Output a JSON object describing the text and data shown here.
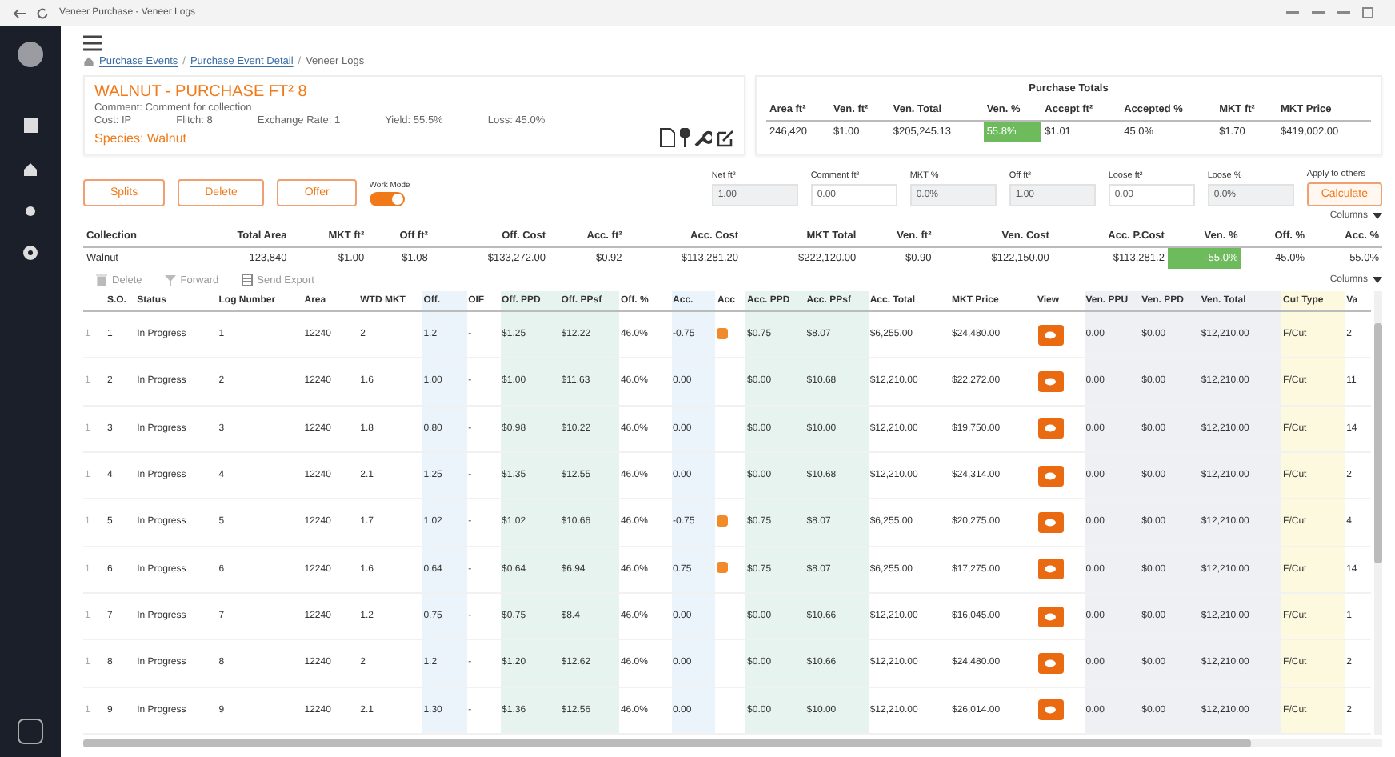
{
  "browser": {
    "title": "Veneer Purchase - Veneer Logs"
  },
  "breadcrumb": {
    "separator": "/",
    "items": [
      {
        "label": "Purchase Events",
        "link": true
      },
      {
        "label": "Purchase Event Detail",
        "link": true
      },
      {
        "label": "Veneer Logs",
        "link": false
      }
    ]
  },
  "header": {
    "title": "WALNUT - PURCHASE FT² 8",
    "comment": "Comment: Comment for collection",
    "facts": [
      "Cost: IP",
      "Flitch: 8",
      "Exchange Rate: 1",
      "Yield: 55.5%",
      "Loss: 45.0%"
    ],
    "species": "Species: Walnut"
  },
  "purchase_totals": {
    "title": "Purchase Totals",
    "columns": [
      "Area ft²",
      "Ven. ft²",
      "Ven. Total",
      "Ven. %",
      "Accept ft²",
      "Accepted %",
      "MKT ft²",
      "MKT Price"
    ],
    "values": [
      {
        "text": "246,420",
        "highlight": false
      },
      {
        "text": "$1.00",
        "highlight": false
      },
      {
        "text": "$205,245.13",
        "highlight": false
      },
      {
        "text": "55.8%",
        "highlight": true
      },
      {
        "text": "$1.01",
        "highlight": false
      },
      {
        "text": "45.0%",
        "highlight": false
      },
      {
        "text": "$1.70",
        "highlight": false
      },
      {
        "text": "$419,002.00",
        "highlight": false
      }
    ]
  },
  "actions": [
    "Splits",
    "Delete",
    "Offer"
  ],
  "work_mode": {
    "label": "Work Mode",
    "on": true
  },
  "fields": [
    {
      "label": "Net ft²",
      "value": "1.00",
      "readonly": true
    },
    {
      "label": "Comment ft²",
      "value": "0.00",
      "readonly": false
    },
    {
      "label": "MKT %",
      "value": "0.0%",
      "readonly": true
    },
    {
      "label": "Off ft²",
      "value": "1.00",
      "readonly": true
    },
    {
      "label": "Loose ft²",
      "value": "0.00",
      "readonly": false
    },
    {
      "label": "Loose %",
      "value": "0.0%",
      "readonly": true
    }
  ],
  "apply": {
    "label": "Apply to others",
    "button": "Calculate"
  },
  "summary": {
    "columns_button": "Columns",
    "columns": [
      "Collection",
      "Total Area",
      "MKT ft²",
      "Off ft²",
      "Off. Cost",
      "Acc. ft²",
      "Acc. Cost",
      "MKT Total",
      "Ven. ft²",
      "Ven. Cost",
      "Acc. P.Cost",
      "Ven. %",
      "Off. %",
      "Acc. %"
    ],
    "row": [
      {
        "text": "Walnut",
        "highlight": false
      },
      {
        "text": "123,840",
        "highlight": false
      },
      {
        "text": "$1.00",
        "highlight": false
      },
      {
        "text": "$1.08",
        "highlight": false
      },
      {
        "text": "$133,272.00",
        "highlight": false
      },
      {
        "text": "$0.92",
        "highlight": false
      },
      {
        "text": "$113,281.20",
        "highlight": false
      },
      {
        "text": "$222,120.00",
        "highlight": false
      },
      {
        "text": "$0.90",
        "highlight": false
      },
      {
        "text": "$122,150.00",
        "highlight": false
      },
      {
        "text": "$113,281.2",
        "highlight": false
      },
      {
        "text": "-55.0%",
        "highlight": true
      },
      {
        "text": "45.0%",
        "highlight": false
      },
      {
        "text": "55.0%",
        "highlight": false
      }
    ]
  },
  "toolbar": [
    {
      "label": "Delete",
      "kind": "trash"
    },
    {
      "label": "Forward",
      "kind": "filter"
    },
    {
      "label": "Send Export",
      "kind": "export"
    }
  ],
  "logs": {
    "columns_button": "Columns",
    "columns": [
      {
        "kind": "text"
      },
      {
        "label": "S.O.",
        "kind": "text"
      },
      {
        "label": "Status",
        "kind": "text"
      },
      {
        "label": "Log Number",
        "kind": "text"
      },
      {
        "label": "Area",
        "kind": "text"
      },
      {
        "label": "WTD MKT",
        "kind": "text"
      },
      {
        "label": "Off.",
        "color": "#eaf4fa",
        "kind": "text"
      },
      {
        "label": "OIF",
        "kind": "text"
      },
      {
        "label": "Off. PPD",
        "color": "#e6f3ee",
        "kind": "text"
      },
      {
        "label": "Off. PPsf",
        "color": "#e6f3ee",
        "kind": "text"
      },
      {
        "label": "Off. %",
        "kind": "text"
      },
      {
        "label": "Acc.",
        "color": "#eaf4fa",
        "kind": "text"
      },
      {
        "label": "Acc",
        "kind": "flag"
      },
      {
        "label": "Acc. PPD",
        "color": "#e6f3ee",
        "kind": "text"
      },
      {
        "label": "Acc. PPsf",
        "color": "#e6f3ee",
        "kind": "text"
      },
      {
        "label": "Acc. Total",
        "kind": "text"
      },
      {
        "label": "MKT Price",
        "kind": "text"
      },
      {
        "label": "View",
        "kind": "view"
      },
      {
        "label": "Ven. PPU",
        "color": "#eef0f4",
        "kind": "text"
      },
      {
        "label": "Ven. PPD",
        "color": "#eef0f4",
        "kind": "text"
      },
      {
        "label": "Ven. Total",
        "color": "#eef0f4",
        "kind": "text"
      },
      {
        "label": "Cut Type",
        "color": "#fdf9df",
        "kind": "text"
      },
      {
        "label": "Va",
        "kind": "text"
      }
    ],
    "rows": [
      {
        "cells": [
          "1",
          "1",
          "In Progress",
          "1",
          "12240",
          "2",
          "1.2",
          "-",
          "$1.25",
          "$12.22",
          "46.0%",
          "-0.75",
          true,
          "$0.75",
          "$8.07",
          "$6,255.00",
          "$24,480.00",
          true,
          "0.00",
          "$0.00",
          "$12,210.00",
          "F/Cut",
          "2"
        ]
      },
      {
        "cells": [
          "1",
          "2",
          "In Progress",
          "2",
          "12240",
          "1.6",
          "1.00",
          "-",
          "$1.00",
          "$11.63",
          "46.0%",
          "0.00",
          false,
          "$0.00",
          "$10.68",
          "$12,210.00",
          "$22,272.00",
          true,
          "0.00",
          "$0.00",
          "$12,210.00",
          "F/Cut",
          "11"
        ]
      },
      {
        "cells": [
          "1",
          "3",
          "In Progress",
          "3",
          "12240",
          "1.8",
          "0.80",
          "-",
          "$0.98",
          "$10.22",
          "46.0%",
          "0.00",
          false,
          "$0.00",
          "$10.00",
          "$12,210.00",
          "$19,750.00",
          true,
          "0.00",
          "$0.00",
          "$12,210.00",
          "F/Cut",
          "14"
        ]
      },
      {
        "cells": [
          "1",
          "4",
          "In Progress",
          "4",
          "12240",
          "2.1",
          "1.25",
          "-",
          "$1.35",
          "$12.55",
          "46.0%",
          "0.00",
          false,
          "$0.00",
          "$10.68",
          "$12,210.00",
          "$24,314.00",
          true,
          "0.00",
          "$0.00",
          "$12,210.00",
          "F/Cut",
          "2"
        ]
      },
      {
        "cells": [
          "1",
          "5",
          "In Progress",
          "5",
          "12240",
          "1.7",
          "1.02",
          "-",
          "$1.02",
          "$10.66",
          "46.0%",
          "-0.75",
          true,
          "$0.75",
          "$8.07",
          "$6,255.00",
          "$20,275.00",
          true,
          "0.00",
          "$0.00",
          "$12,210.00",
          "F/Cut",
          "4"
        ]
      },
      {
        "cells": [
          "1",
          "6",
          "In Progress",
          "6",
          "12240",
          "1.6",
          "0.64",
          "-",
          "$0.64",
          "$6.94",
          "46.0%",
          "0.75",
          true,
          "$0.75",
          "$8.07",
          "$6,255.00",
          "$17,275.00",
          true,
          "0.00",
          "$0.00",
          "$12,210.00",
          "F/Cut",
          "14"
        ]
      },
      {
        "cells": [
          "1",
          "7",
          "In Progress",
          "7",
          "12240",
          "1.2",
          "0.75",
          "-",
          "$0.75",
          "$8.4",
          "46.0%",
          "0.00",
          false,
          "$0.00",
          "$10.66",
          "$12,210.00",
          "$16,045.00",
          true,
          "0.00",
          "$0.00",
          "$12,210.00",
          "F/Cut",
          "1"
        ]
      },
      {
        "cells": [
          "1",
          "8",
          "In Progress",
          "8",
          "12240",
          "2",
          "1.2",
          "-",
          "$1.20",
          "$12.62",
          "46.0%",
          "0.00",
          false,
          "$0.00",
          "$10.66",
          "$12,210.00",
          "$24,480.00",
          true,
          "0.00",
          "$0.00",
          "$12,210.00",
          "F/Cut",
          "2"
        ]
      },
      {
        "cells": [
          "1",
          "9",
          "In Progress",
          "9",
          "12240",
          "2.1",
          "1.30",
          "-",
          "$1.36",
          "$12.56",
          "46.0%",
          "0.00",
          false,
          "$0.00",
          "$10.00",
          "$12,210.00",
          "$26,014.00",
          true,
          "0.00",
          "$0.00",
          "$12,210.00",
          "F/Cut",
          "2"
        ]
      }
    ]
  }
}
